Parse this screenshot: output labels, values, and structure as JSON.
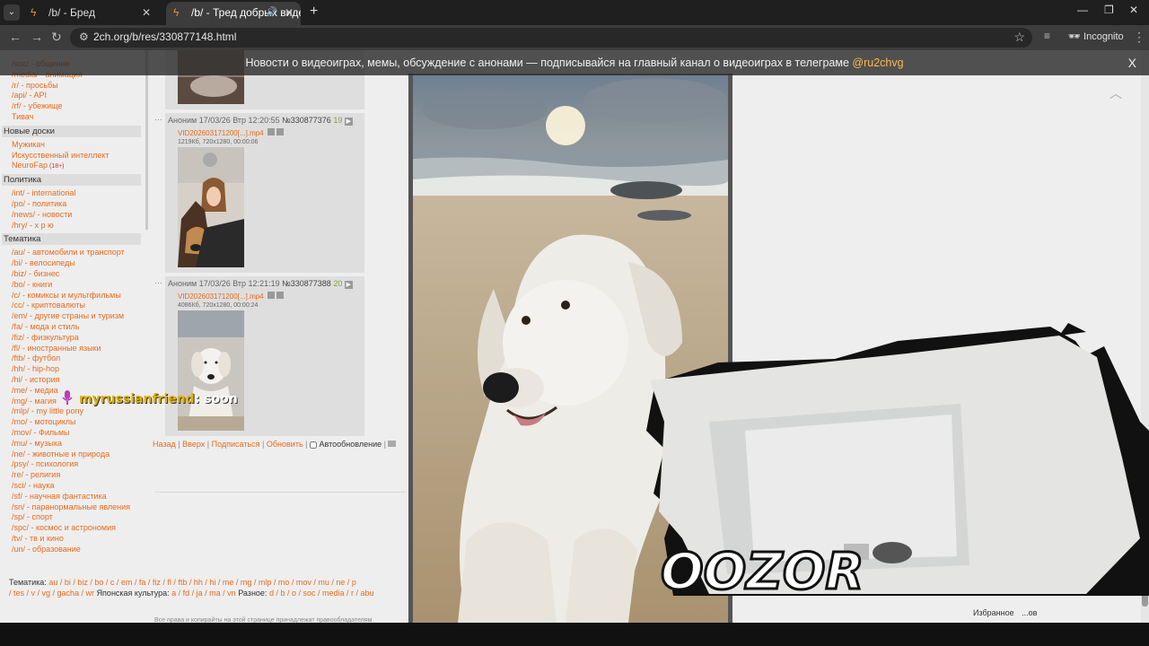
{
  "browser": {
    "tabs": [
      {
        "title": "/b/ - Бред",
        "active": false
      },
      {
        "title": "/b/ - Тред добрых видео. (",
        "active": true
      }
    ],
    "url": "2ch.org/b/res/330877148.html",
    "incognito_label": "Incognito"
  },
  "banner": {
    "text": "Новости о видеоиграх, мемы, обсуждение с анонами — подписывайся на главный канал о видеоиграх в телеграме ",
    "handle": "@ru2chvg",
    "close": "X"
  },
  "sidebar": {
    "top_links": [
      {
        "board": "/soc/",
        "name": "общение"
      },
      {
        "board": "/media/",
        "name": "анимация"
      },
      {
        "board": "/r/",
        "name": "просьбы"
      },
      {
        "board": "/api/",
        "name": "API"
      },
      {
        "board": "/rf/",
        "name": "убежище"
      }
    ],
    "tivach": "Тивач",
    "new_boards_title": "Новые доски",
    "new_boards": [
      "Мужикач",
      "Искусственный интеллект",
      "NeuroFap"
    ],
    "neurofap_badge": "(18+)",
    "politics_title": "Политика",
    "politics": [
      {
        "board": "/int/",
        "name": "international"
      },
      {
        "board": "/po/",
        "name": "политика"
      },
      {
        "board": "/news/",
        "name": "новости"
      },
      {
        "board": "/hry/",
        "name": "х р ю"
      }
    ],
    "thematic_title": "Тематика",
    "thematic": [
      {
        "board": "/au/",
        "name": "автомобили и транспорт"
      },
      {
        "board": "/bi/",
        "name": "велосипеды"
      },
      {
        "board": "/biz/",
        "name": "бизнес"
      },
      {
        "board": "/bo/",
        "name": "книги"
      },
      {
        "board": "/c/",
        "name": "комиксы и мультфильмы"
      },
      {
        "board": "/cc/",
        "name": "криптовалюты"
      },
      {
        "board": "/em/",
        "name": "другие страны и туризм"
      },
      {
        "board": "/fa/",
        "name": "мода и стиль"
      },
      {
        "board": "/fiz/",
        "name": "физкультура"
      },
      {
        "board": "/fl/",
        "name": "иностранные языки"
      },
      {
        "board": "/ftb/",
        "name": "футбол"
      },
      {
        "board": "/hh/",
        "name": "hip-hop"
      },
      {
        "board": "/hi/",
        "name": "история"
      },
      {
        "board": "/me/",
        "name": "медиа"
      },
      {
        "board": "/mg/",
        "name": "магия"
      },
      {
        "board": "/mlp/",
        "name": "my little pony"
      },
      {
        "board": "/mo/",
        "name": "мотоциклы"
      },
      {
        "board": "/mov/",
        "name": "Фильмы"
      },
      {
        "board": "/mu/",
        "name": "музыка"
      },
      {
        "board": "/ne/",
        "name": "животные и природа"
      },
      {
        "board": "/psy/",
        "name": "психология"
      },
      {
        "board": "/re/",
        "name": "религия"
      },
      {
        "board": "/sci/",
        "name": "наука"
      },
      {
        "board": "/sf/",
        "name": "научная фантастика"
      },
      {
        "board": "/sn/",
        "name": "паранормальные явления"
      },
      {
        "board": "/sp/",
        "name": "спорт"
      },
      {
        "board": "/spc/",
        "name": "космос и астрономия"
      },
      {
        "board": "/tv/",
        "name": "тв и кино"
      },
      {
        "board": "/un/",
        "name": "образование"
      }
    ]
  },
  "posts": [
    {
      "author": "Аноним",
      "date": "17/03/26 Втр 12:20:55",
      "number": "№330877376",
      "count": "19",
      "file": "VID202603171200[...].mp4",
      "meta": "1219Кб, 720x1280, 00:00:06"
    },
    {
      "author": "Аноним",
      "date": "17/03/26 Втр 12:21:19",
      "number": "№330877388",
      "count": "20",
      "file": "VID202603171200[...].mp4",
      "meta": "4086Кб, 720x1280, 00:00:24"
    }
  ],
  "thread_links": {
    "back": "Назад",
    "top": "Вверх",
    "subscribe": "Подписаться",
    "refresh": "Обновить",
    "autorefresh": "Автообновление"
  },
  "footer": {
    "line1_label": "Тематика:",
    "line1": "au / bi / biz / bo / c / em / fa / fiz / fl / ftb / hh / hi / me / mg / mlp / mo / mov / mu / ne / p",
    "line2": "/ tes / v / vg / gacha / wr",
    "line2_jp_label": "Японская культура:",
    "line2_jp": "a / fd / ja / ma / vn",
    "line2_misc_label": "Разное:",
    "line2_misc": "d / b / o / soc / media / r / abu",
    "right_link": "ruvn",
    "favorites": "Избранное",
    "right_trail": "...ов",
    "copyright": "Все права и копирайты на этой странице принадлежат правообладателям"
  },
  "overlay": {
    "chat_user": "myrussianfriend",
    "chat_message": ": soon",
    "brand": "OOZOR"
  },
  "colors": {
    "accent": "#e86b1d",
    "post_bg": "#dedede",
    "page_bg": "#eeeeee",
    "banner_handle": "#ffb84d"
  }
}
